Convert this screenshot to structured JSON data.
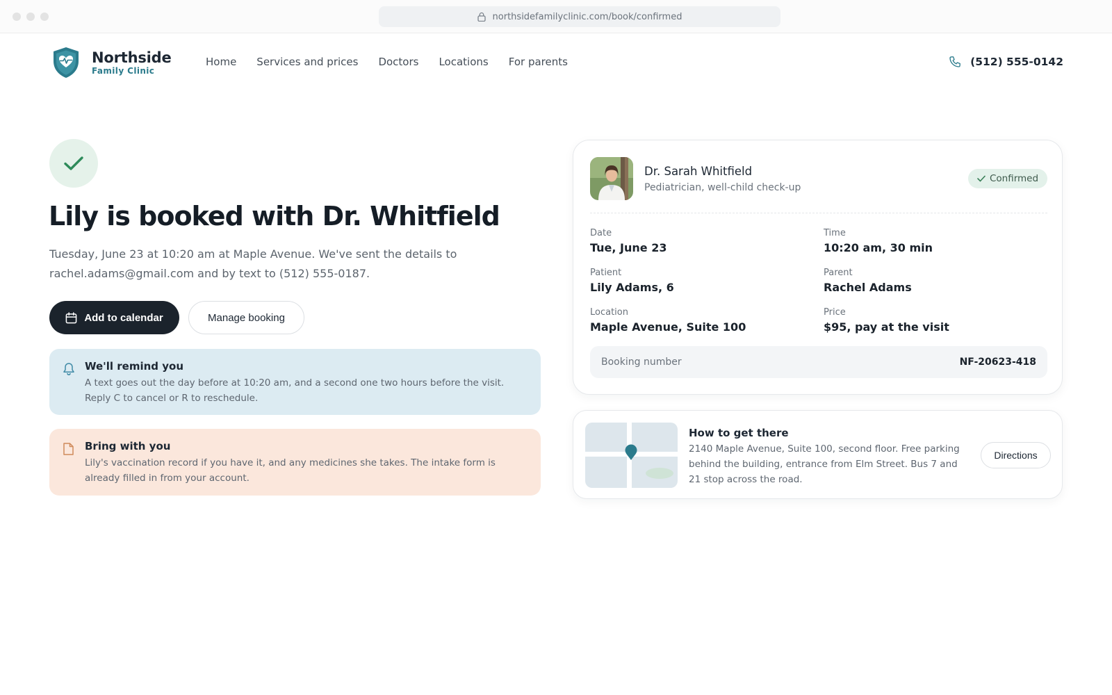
{
  "browser": {
    "url": "northsidefamilyclinic.com/book/confirmed"
  },
  "header": {
    "logo_name": "Northside",
    "logo_sub": "Family Clinic",
    "nav": [
      "Home",
      "Services and prices",
      "Doctors",
      "Locations",
      "For parents"
    ],
    "phone": "(512) 555-0142"
  },
  "confirmation": {
    "headline": "Lily is booked with Dr. Whitfield",
    "subtext": "Tuesday, June 23 at 10:20 am at Maple Avenue. We've sent the details to rachel.adams@gmail.com and by text to (512) 555-0187.",
    "add_calendar_label": "Add to calendar",
    "manage_label": "Manage booking"
  },
  "notices": {
    "reminder": {
      "title": "We'll remind you",
      "body": "A text goes out the day before at 10:20 am, and a second one two hours before the visit. Reply C to cancel or R to reschedule."
    },
    "bring": {
      "title": "Bring with you",
      "body": "Lily's vaccination record if you have it, and any medicines she takes. The intake form is already filled in from your account."
    }
  },
  "appointment": {
    "doctor_name": "Dr. Sarah Whitfield",
    "doctor_role": "Pediatrician, well-child check-up",
    "status": "Confirmed",
    "fields": {
      "date_label": "Date",
      "date": "Tue, June 23",
      "time_label": "Time",
      "time": "10:20 am, 30 min",
      "patient_label": "Patient",
      "patient": "Lily Adams, 6",
      "parent_label": "Parent",
      "parent": "Rachel Adams",
      "location_label": "Location",
      "location": "Maple Avenue, Suite 100",
      "price_label": "Price",
      "price": "$95, pay at the visit"
    },
    "booking_label": "Booking number",
    "booking_number": "NF-20623-418"
  },
  "directions": {
    "title": "How to get there",
    "body": "2140 Maple Avenue, Suite 100, second floor. Free parking behind the building, entrance from Elm Street. Bus 7 and 21 stop across the road.",
    "button_label": "Directions"
  },
  "colors": {
    "primary_dark": "#1b232c",
    "brand_teal": "#2b7b8c",
    "success_green": "#2e8b5a",
    "reminder_bg": "#dcebf2",
    "bring_bg": "#fbe7dc"
  }
}
